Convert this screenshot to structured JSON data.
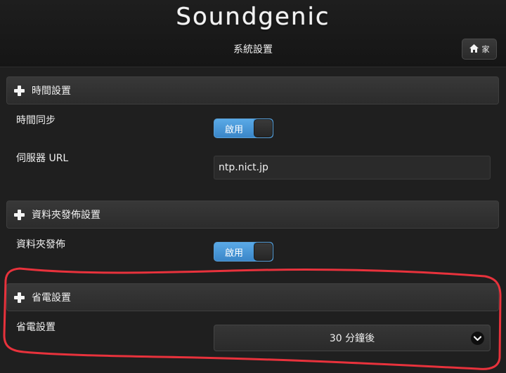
{
  "header": {
    "logo_text": "Soundgenic",
    "page_title": "系統設置",
    "home_label": "家"
  },
  "sections": {
    "time": {
      "title": "時間設置",
      "sync_label": "時間同步",
      "sync_toggle": "啟用",
      "server_label": "伺服器 URL",
      "server_value": "ntp.nict.jp"
    },
    "folder": {
      "title": "資料夾發佈設置",
      "publish_label": "資料夾發佈",
      "publish_toggle": "啟用"
    },
    "power": {
      "title": "省電設置",
      "field_label": "省電設置",
      "selected_option": "30 分鐘後"
    }
  },
  "annotation": {
    "color": "#e8323c"
  }
}
